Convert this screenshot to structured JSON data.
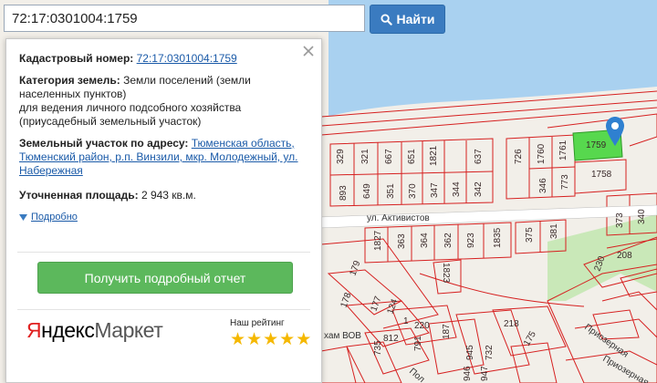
{
  "search": {
    "value": "72:17:0301004:1759",
    "button_label": "Найти"
  },
  "popup": {
    "cadastral_label": "Кадастровый номер:",
    "cadastral_value": "72:17:0301004:1759",
    "category_label": "Категория земель:",
    "category_value_line1": "Земли поселений (земли",
    "category_value_line2": "населенных пунктов)",
    "purpose_line1": "для ведения личного подсобного хозяйства",
    "purpose_line2": "(приусадебный земельный участок)",
    "address_label": "Земельный участок по адресу:",
    "address_line1": "Тюменская область,",
    "address_line2": "Тюменский район, р.п. Винзили, мкр. Молодежный, ул.",
    "address_line3": "Набережная",
    "area_label": "Уточненная площадь:",
    "area_value": "2 943 кв.м.",
    "details_link": "Подробно",
    "report_button": "Получить подробный отчет"
  },
  "promo": {
    "logo_part1": "Я",
    "logo_part2": "ндекс",
    "logo_part3": "Маркет",
    "rating_label": "Наш рейтинг",
    "rating_stars": 5
  },
  "map": {
    "colors": {
      "water": "#a9d1f0",
      "land": "#f2efe9",
      "green": "#c9e8b8",
      "parcel": "#d62020",
      "selected": "#57d84e",
      "road": "#ffffff",
      "marker": "#2f80d0"
    },
    "street_activistov": "ул. Активистов",
    "street_vov": "хам ВОВ",
    "street_priozer": "Приозерная",
    "street_pol": "Пол",
    "parcel_labels": [
      "329",
      "321",
      "667",
      "651",
      "1821",
      "637",
      "893",
      "649",
      "351",
      "370",
      "347",
      "344",
      "342",
      "726",
      "1760",
      "1761",
      "1759",
      "346",
      "773",
      "1758",
      "373",
      "340",
      "1827",
      "363",
      "364",
      "362",
      "923",
      "1835",
      "375",
      "381",
      "1823",
      "208",
      "230",
      "179",
      "178",
      "124",
      "177",
      "1",
      "812",
      "220",
      "187",
      "791",
      "735",
      "734",
      "945",
      "732",
      "931",
      "946",
      "947",
      "186",
      "225",
      "218",
      "175"
    ]
  }
}
